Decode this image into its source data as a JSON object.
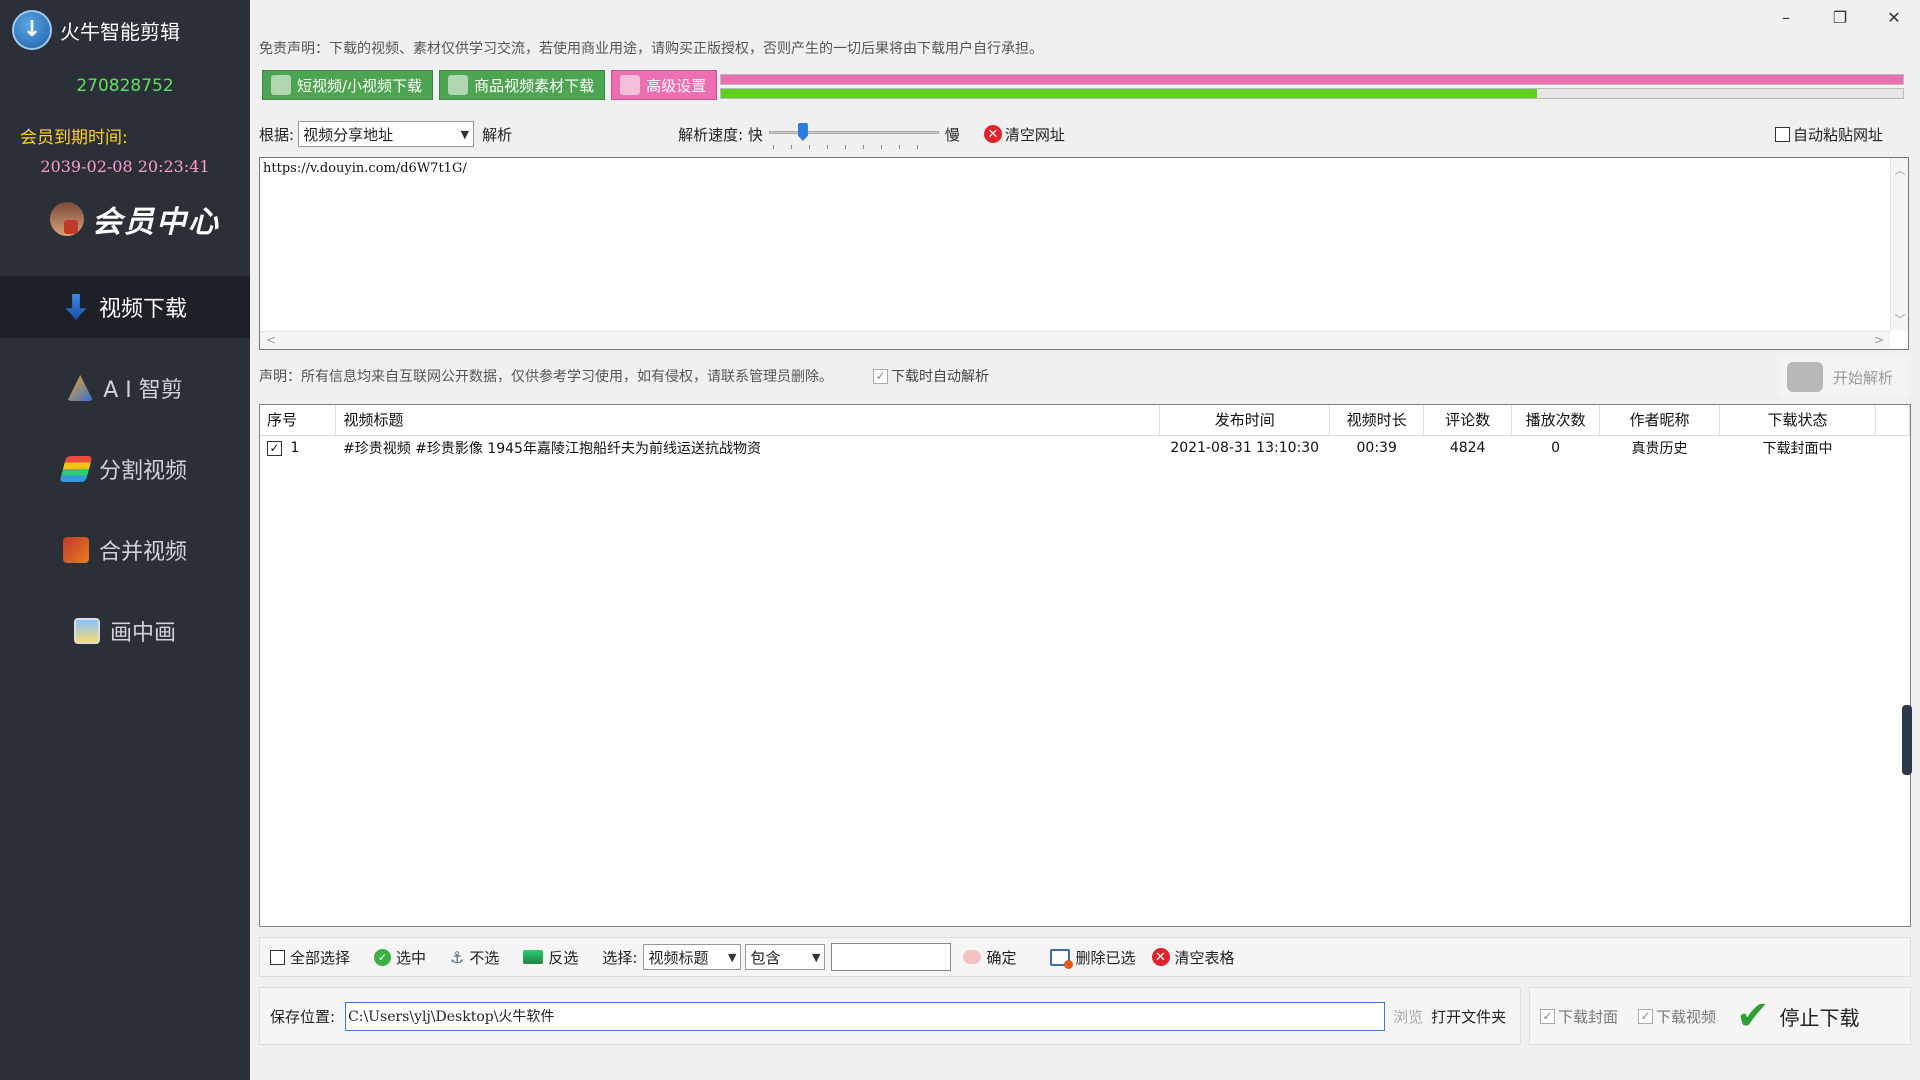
{
  "sidebar": {
    "app_title": "火牛智能剪辑",
    "user_id": "270828752",
    "expire_label": "会员到期时间:",
    "expire_date": "2039-02-08 20:23:41",
    "member_center": "会员中心",
    "nav": [
      {
        "label": "视频下载",
        "icon": "download-arrow-icon",
        "active": true
      },
      {
        "label": "A I 智剪",
        "icon": "ai-edit-icon",
        "active": false
      },
      {
        "label": "分割视频",
        "icon": "split-video-icon",
        "active": false
      },
      {
        "label": "合并视频",
        "icon": "merge-video-icon",
        "active": false
      },
      {
        "label": "画中画",
        "icon": "picture-in-picture-icon",
        "active": false
      }
    ]
  },
  "header": {
    "disclaimer": "免责声明：下载的视频、素材仅供学习交流，若使用商业用途，请购买正版授权，否则产生的一切后果将由下载用户自行承担。"
  },
  "toolbar": {
    "short_video_label": "短视频/小视频下载",
    "product_video_label": "商品视频素材下载",
    "advanced_label": "高级设置"
  },
  "progress": {
    "bar1": 1.0,
    "bar2": 0.69,
    "bar1_color": "#ee6fb1",
    "bar2_color": "#5cd11e"
  },
  "parse": {
    "basis_label": "根据:",
    "basis_value": "视频分享地址",
    "parse_label": "解析",
    "speed_label": "解析速度: 快",
    "slow_label": "慢",
    "speed_level": 0.2,
    "clear_url_label": "清空网址",
    "auto_paste_label": "自动粘贴网址"
  },
  "url_input": {
    "value": "https://v.douyin.com/d6W7t1G/"
  },
  "notice": {
    "text": "声明：所有信息均来自互联网公开数据，仅供参考学习使用，如有侵权，请联系管理员删除。",
    "auto_parse_label": "下载时自动解析",
    "start_parse_label": "开始解析"
  },
  "table": {
    "headers": [
      "序号",
      "视频标题",
      "发布时间",
      "视频时长",
      "评论数",
      "播放次数",
      "作者昵称",
      "下载状态"
    ],
    "rows": [
      {
        "checked": true,
        "index": "1",
        "title": "#珍贵视频 #珍贵影像 1945年嘉陵江抱船纤夫为前线运送抗战物资",
        "publish_time": "2021-08-31 13:10:30",
        "duration": "00:39",
        "comments": "4824",
        "plays": "0",
        "author": "真贵历史",
        "status": "下载封面中"
      }
    ]
  },
  "bottom": {
    "select_all_label": "全部选择",
    "select_label": "选中",
    "deselect_label": "不选",
    "invert_label": "反选",
    "choose_label": "选择:",
    "field_value": "视频标题",
    "match_value": "包含",
    "filter_value": "",
    "confirm_label": "确定",
    "delete_selected_label": "删除已选",
    "clear_table_label": "清空表格"
  },
  "save": {
    "label": "保存位置:",
    "path": "C:\\Users\\ylj\\Desktop\\火牛软件",
    "browse_label": "浏览",
    "open_folder_label": "打开文件夹",
    "download_cover_label": "下载封面",
    "download_video_label": "下载视频",
    "stop_label": "停止下载"
  },
  "window": {
    "minimize": "–",
    "restore": "❐",
    "close": "✕"
  }
}
